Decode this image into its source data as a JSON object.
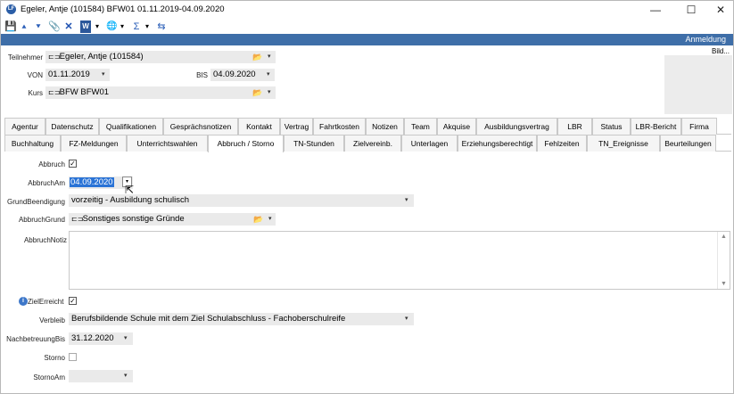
{
  "window": {
    "title": "Egeler, Antje (101584)  BFW01  01.11.2019-04.09.2020",
    "app_icon": "LF",
    "controls": {
      "minimize": "—",
      "maximize": "☐",
      "close": "✕"
    }
  },
  "toolbar": {
    "save": "💾",
    "up": "⯅",
    "down": "⯆",
    "attach": "📎",
    "delete": "✕",
    "word": "W",
    "dropdown1": "▾",
    "globe": "🌐",
    "dropdown2": "▾",
    "sigma": "Σ",
    "dropdown3": "▾",
    "swap": "⇆"
  },
  "banner": {
    "label": "Anmeldung"
  },
  "header": {
    "bild_label": "Bild...",
    "teilnehmer_label": "Teilnehmer",
    "teilnehmer_value": "Egeler, Antje (101584)",
    "von_label": "VON",
    "von_value": "01.11.2019",
    "bis_label": "BIS",
    "bis_value": "04.09.2020",
    "kurs_label": "Kurs",
    "kurs_value": "BFW BFW01",
    "link_glyph": "⊏⊐",
    "folder_glyph": "📂",
    "arrow_glyph": "▾"
  },
  "tabs_row1": [
    "Agentur",
    "Datenschutz",
    "Qualifikationen",
    "Gesprächsnotizen",
    "Kontakt",
    "Vertrag",
    "Fahrtkosten",
    "Notizen",
    "Team",
    "Akquise",
    "Ausbildungsvertrag",
    "LBR",
    "Status",
    "LBR-Bericht",
    "Firma"
  ],
  "tabs_row2": [
    "Buchhaltung",
    "FZ-Meldungen",
    "Unterrichtswahlen",
    "Abbruch / Storno",
    "TN-Stunden",
    "Zielvereinb.",
    "Unterlagen",
    "Erziehungsberechtigt",
    "Fehlzeiten",
    "TN_Ereignisse",
    "Beurteilungen"
  ],
  "active_tab": "Abbruch / Storno",
  "form": {
    "abbruch_label": "Abbruch",
    "abbruch_checked": "✓",
    "abbruch_am_label": "AbbruchAm",
    "abbruch_am_value": "04.09.2020",
    "grund_beendigung_label": "GrundBeendigung",
    "grund_beendigung_value": "vorzeitig - Ausbildung schulisch",
    "abbruch_grund_label": "AbbruchGrund",
    "abbruch_grund_value": "Sonstiges sonstige Gründe",
    "abbruch_notiz_label": "AbbruchNotiz",
    "ziel_erreicht_label": "ZielErreicht",
    "ziel_erreicht_checked": "✓",
    "info_glyph": "i",
    "verbleib_label": "Verbleib",
    "verbleib_value": "Berufsbildende Schule mit dem Ziel Schulabschluss - Fachoberschulreife",
    "nachbetreuung_label": "NachbetreuungBis",
    "nachbetreuung_value": "31.12.2020",
    "storno_label": "Storno",
    "storno_am_label": "StornoAm"
  },
  "colors": {
    "banner": "#3e6ea8",
    "selection": "#2a73d6",
    "field_bg": "#eaeaea"
  }
}
